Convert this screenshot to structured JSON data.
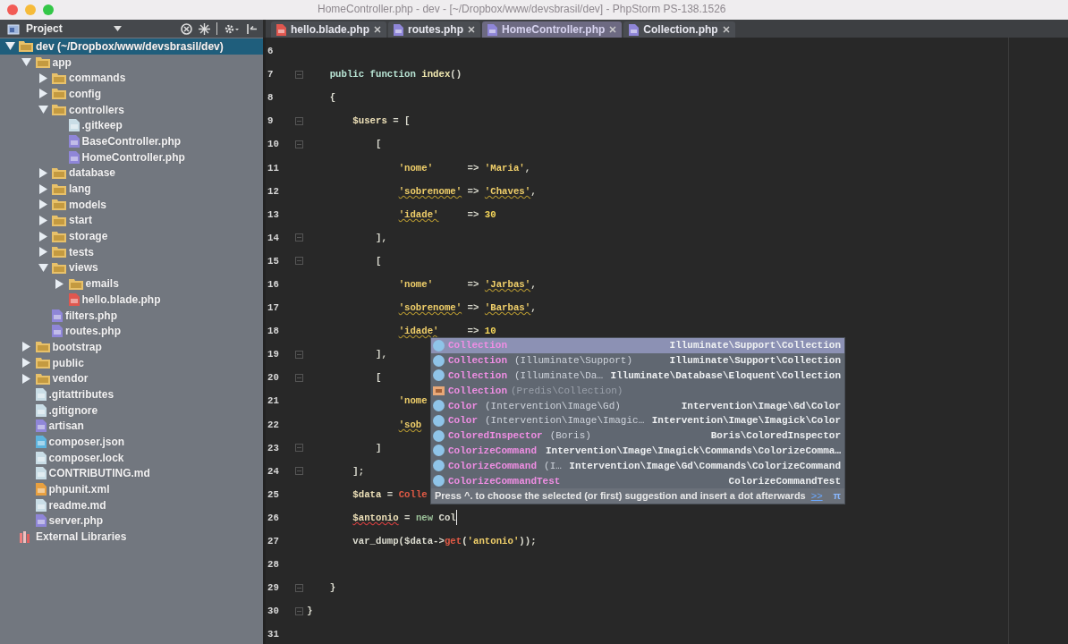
{
  "window": {
    "title": "HomeController.php - dev - [~/Dropbox/www/devsbrasil/dev] - PhpStorm PS-138.1526"
  },
  "sidebar": {
    "title": "Project",
    "tree": [
      {
        "label": "dev (~/Dropbox/www/devsbrasil/dev)",
        "kind": "folder",
        "expanded": true,
        "selected": true,
        "children": [
          {
            "label": "app",
            "kind": "folder",
            "expanded": true,
            "selected": false,
            "children": [
              {
                "label": "commands",
                "kind": "folder",
                "expanded": false,
                "selected": false
              },
              {
                "label": "config",
                "kind": "folder",
                "expanded": false,
                "selected": false
              },
              {
                "label": "controllers",
                "kind": "folder",
                "expanded": true,
                "selected": false,
                "children": [
                  {
                    "label": ".gitkeep",
                    "kind": "text",
                    "selected": false
                  },
                  {
                    "label": "BaseController.php",
                    "kind": "php",
                    "selected": false
                  },
                  {
                    "label": "HomeController.php",
                    "kind": "php",
                    "selected": false
                  }
                ]
              },
              {
                "label": "database",
                "kind": "folder",
                "expanded": false,
                "selected": false
              },
              {
                "label": "lang",
                "kind": "folder",
                "expanded": false,
                "selected": false
              },
              {
                "label": "models",
                "kind": "folder",
                "expanded": false,
                "selected": false
              },
              {
                "label": "start",
                "kind": "folder",
                "expanded": false,
                "selected": false
              },
              {
                "label": "storage",
                "kind": "folder",
                "expanded": false,
                "selected": false
              },
              {
                "label": "tests",
                "kind": "folder",
                "expanded": false,
                "selected": false
              },
              {
                "label": "views",
                "kind": "folder",
                "expanded": true,
                "selected": false,
                "children": [
                  {
                    "label": "emails",
                    "kind": "folder",
                    "expanded": false,
                    "selected": false
                  },
                  {
                    "label": "hello.blade.php",
                    "kind": "blade",
                    "selected": false
                  }
                ]
              },
              {
                "label": "filters.php",
                "kind": "php",
                "selected": false
              },
              {
                "label": "routes.php",
                "kind": "php",
                "selected": false
              }
            ]
          },
          {
            "label": "bootstrap",
            "kind": "folder",
            "expanded": false,
            "selected": false
          },
          {
            "label": "public",
            "kind": "folder",
            "expanded": false,
            "selected": false
          },
          {
            "label": "vendor",
            "kind": "folder",
            "expanded": false,
            "selected": false
          },
          {
            "label": ".gitattributes",
            "kind": "text",
            "selected": false
          },
          {
            "label": ".gitignore",
            "kind": "text",
            "selected": false
          },
          {
            "label": "artisan",
            "kind": "php",
            "selected": false
          },
          {
            "label": "composer.json",
            "kind": "json",
            "selected": false
          },
          {
            "label": "composer.lock",
            "kind": "text",
            "selected": false
          },
          {
            "label": "CONTRIBUTING.md",
            "kind": "text",
            "selected": false
          },
          {
            "label": "phpunit.xml",
            "kind": "xml",
            "selected": false
          },
          {
            "label": "readme.md",
            "kind": "text",
            "selected": false
          },
          {
            "label": "server.php",
            "kind": "php",
            "selected": false
          }
        ]
      },
      {
        "label": "External Libraries",
        "kind": "library",
        "selected": false
      }
    ]
  },
  "tabs": [
    {
      "label": "hello.blade.php",
      "kind": "blade",
      "selected": false
    },
    {
      "label": "routes.php",
      "kind": "php",
      "selected": false
    },
    {
      "label": "HomeController.php",
      "kind": "php",
      "selected": true
    },
    {
      "label": "Collection.php",
      "kind": "php",
      "selected": false
    }
  ],
  "editor": {
    "lines": [
      {
        "number": "6"
      },
      {
        "number": "7",
        "fold": true,
        "tokens": [
          {
            "text": "    public function ",
            "kind": "keyword"
          },
          {
            "text": "index",
            "kind": "name"
          },
          {
            "text": "()",
            "kind": "punct"
          }
        ]
      },
      {
        "number": "8",
        "tokens": [
          {
            "text": "    {",
            "kind": "punct"
          }
        ]
      },
      {
        "number": "9",
        "fold": true,
        "tokens": [
          {
            "text": "        $users",
            "kind": "var"
          },
          {
            "text": " = [",
            "kind": "punct"
          }
        ]
      },
      {
        "number": "10",
        "fold": true,
        "tokens": [
          {
            "text": "            [",
            "kind": "punct"
          }
        ]
      },
      {
        "number": "11",
        "tokens": [
          {
            "text": "                'nome'",
            "kind": "string"
          },
          {
            "text": "      => ",
            "kind": "punct"
          },
          {
            "text": "'Maria'",
            "kind": "string"
          },
          {
            "text": ",",
            "kind": "punct"
          }
        ]
      },
      {
        "number": "12",
        "tokens": [
          {
            "text": "                'sobrenome'",
            "kind": "string",
            "warning": true
          },
          {
            "text": " => ",
            "kind": "punct"
          },
          {
            "text": "'Chaves'",
            "kind": "string",
            "warning": true
          },
          {
            "text": ",",
            "kind": "punct"
          }
        ]
      },
      {
        "number": "13",
        "tokens": [
          {
            "text": "                'idade'",
            "kind": "string",
            "warning": true
          },
          {
            "text": "     => ",
            "kind": "punct"
          },
          {
            "text": "30",
            "kind": "number"
          }
        ]
      },
      {
        "number": "14",
        "fold": true,
        "tokens": [
          {
            "text": "            ],",
            "kind": "punct"
          }
        ]
      },
      {
        "number": "15",
        "fold": true,
        "tokens": [
          {
            "text": "            [",
            "kind": "punct"
          }
        ]
      },
      {
        "number": "16",
        "tokens": [
          {
            "text": "                'nome'",
            "kind": "string"
          },
          {
            "text": "      => ",
            "kind": "punct"
          },
          {
            "text": "'Jarbas'",
            "kind": "string",
            "warning": true
          },
          {
            "text": ",",
            "kind": "punct"
          }
        ]
      },
      {
        "number": "17",
        "tokens": [
          {
            "text": "                'sobrenome'",
            "kind": "string",
            "warning": true
          },
          {
            "text": " => ",
            "kind": "punct"
          },
          {
            "text": "'Barbas'",
            "kind": "string",
            "warning": true
          },
          {
            "text": ",",
            "kind": "punct"
          }
        ]
      },
      {
        "number": "18",
        "tokens": [
          {
            "text": "                'idade'",
            "kind": "string",
            "warning": true
          },
          {
            "text": "     => ",
            "kind": "punct"
          },
          {
            "text": "10",
            "kind": "number"
          }
        ]
      },
      {
        "number": "19",
        "fold": true,
        "tokens": [
          {
            "text": "            ],",
            "kind": "punct"
          }
        ]
      },
      {
        "number": "20",
        "fold": true,
        "tokens": [
          {
            "text": "            [",
            "kind": "punct"
          }
        ]
      },
      {
        "number": "21",
        "tokens": [
          {
            "text": "                'nome",
            "kind": "string"
          }
        ]
      },
      {
        "number": "22",
        "tokens": [
          {
            "text": "                'sob",
            "kind": "string",
            "warning": true
          }
        ]
      },
      {
        "number": "23",
        "fold": true,
        "tokens": [
          {
            "text": "            ]",
            "kind": "punct"
          }
        ]
      },
      {
        "number": "24",
        "fold": true,
        "tokens": [
          {
            "text": "        ];",
            "kind": "punct"
          }
        ]
      },
      {
        "number": "25",
        "tokens": [
          {
            "text": "        $data",
            "kind": "var"
          },
          {
            "text": " = ",
            "kind": "punct"
          },
          {
            "text": "Colle",
            "kind": "call"
          }
        ]
      },
      {
        "number": "26",
        "caret": true,
        "tokens": [
          {
            "text": "        $antonio",
            "kind": "var",
            "error": true
          },
          {
            "text": " = ",
            "kind": "punct"
          },
          {
            "text": "new",
            "kind": "new"
          },
          {
            "text": " Col",
            "kind": "punct"
          }
        ]
      },
      {
        "number": "27",
        "tokens": [
          {
            "text": "        var_dump($data->",
            "kind": "punct"
          },
          {
            "text": "get",
            "kind": "call"
          },
          {
            "text": "(",
            "kind": "punct"
          },
          {
            "text": "'antonio'",
            "kind": "string"
          },
          {
            "text": "));",
            "kind": "punct"
          }
        ]
      },
      {
        "number": "28"
      },
      {
        "number": "29",
        "fold": true,
        "tokens": [
          {
            "text": "    }",
            "kind": "punct"
          }
        ]
      },
      {
        "number": "30",
        "fold": true,
        "tokens": [
          {
            "text": "}",
            "kind": "punct"
          }
        ]
      },
      {
        "number": "31"
      }
    ]
  },
  "completion": {
    "items": [
      {
        "name": "Collection",
        "kind": "class",
        "type": "Illuminate\\Support\\Collection",
        "selected": true
      },
      {
        "name": "Collection",
        "detail": "(Illuminate\\Support)",
        "kind": "class",
        "type": "Illuminate\\Support\\Collection",
        "selected": false
      },
      {
        "name": "Collection",
        "detail": "(Illuminate\\Da…",
        "kind": "class",
        "type": "Illuminate\\Database\\Eloquent\\Collection",
        "selected": false
      },
      {
        "name": "Collection",
        "detail": "(Predis\\Collection)",
        "kind": "namespace",
        "selected": false
      },
      {
        "name": "Color",
        "detail": "(Intervention\\Image\\Gd)",
        "kind": "class",
        "type": "Intervention\\Image\\Gd\\Color",
        "selected": false
      },
      {
        "name": "Color",
        "detail": "(Intervention\\Image\\Imagic…",
        "kind": "class",
        "type": "Intervention\\Image\\Imagick\\Color",
        "selected": false
      },
      {
        "name": "ColoredInspector",
        "detail": "(Boris)",
        "kind": "class",
        "type": "Boris\\ColoredInspector",
        "selected": false
      },
      {
        "name": "ColorizeCommand",
        "kind": "class",
        "type": "Intervention\\Image\\Imagick\\Commands\\ColorizeComma…",
        "selected": false
      },
      {
        "name": "ColorizeCommand",
        "detail": "(I…",
        "kind": "class",
        "type": "Intervention\\Image\\Gd\\Commands\\ColorizeCommand",
        "selected": false
      },
      {
        "name": "ColorizeCommandTest",
        "kind": "class",
        "type": "ColorizeCommandTest",
        "selected": false
      }
    ],
    "hint": "Press ^. to choose the selected (or first) suggestion and insert a dot afterwards",
    "hint_link": ">>",
    "corner_mark": "π"
  }
}
